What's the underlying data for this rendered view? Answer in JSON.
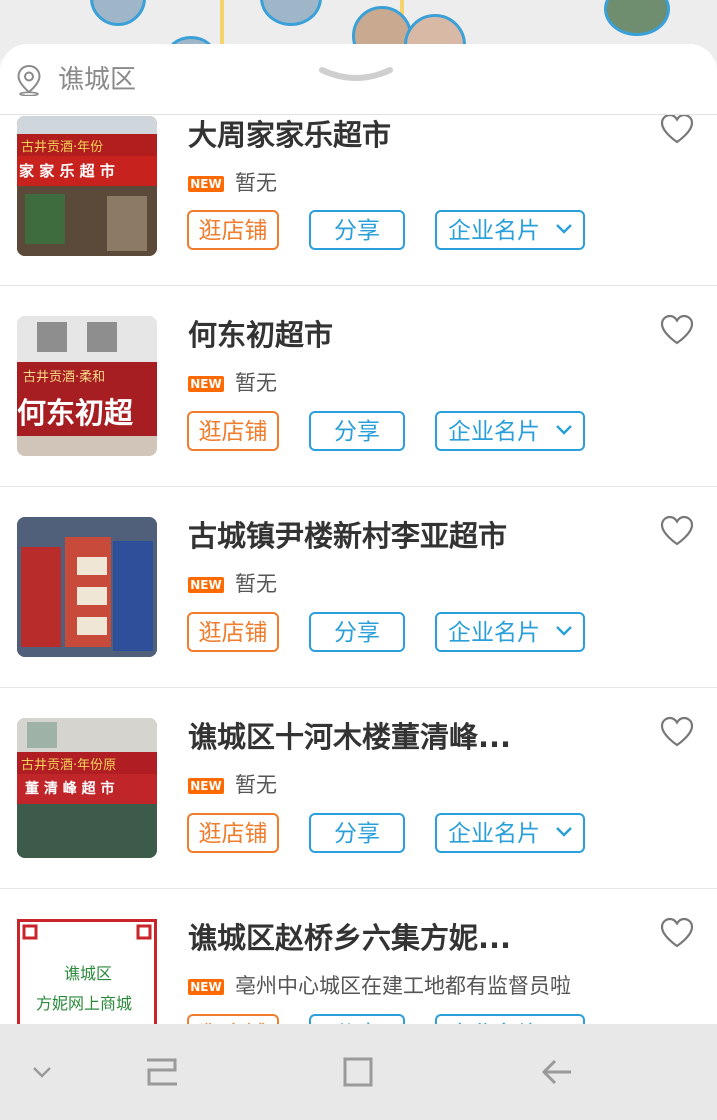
{
  "location": {
    "label": "谯城区"
  },
  "badge_text": "NEW",
  "buttons": {
    "shop": "逛店铺",
    "share": "分享",
    "card": "企业名片"
  },
  "stores": [
    {
      "name": "大周家家乐超市",
      "desc": "暂无",
      "thumb_sign": "家 家 乐 超 市",
      "thumb_top": "古井贡酒·年份"
    },
    {
      "name": "何东初超市",
      "desc": "暂无",
      "thumb_sign": "何东初超",
      "thumb_top": "古井贡酒·柔和"
    },
    {
      "name": "古城镇尹楼新村李亚超市",
      "desc": "暂无",
      "thumb_sign": "",
      "thumb_top": ""
    },
    {
      "name": "谯城区十河木楼董清峰...",
      "desc": "暂无",
      "thumb_sign": "董 清 峰 超 市",
      "thumb_top": "古井贡酒·年份原"
    },
    {
      "name": "谯城区赵桥乡六集方妮...",
      "desc": "亳州中心城区在建工地都有监督员啦",
      "thumb_sign": "谯城区",
      "thumb_top": "方妮网上商城"
    }
  ],
  "colors": {
    "orange": "#f07d2e",
    "blue": "#2a9fd9",
    "badge": "#ff6a00"
  },
  "icons": {
    "location": "location-pin-icon",
    "heart": "heart-outline-icon",
    "chevron": "chevron-down-icon"
  }
}
